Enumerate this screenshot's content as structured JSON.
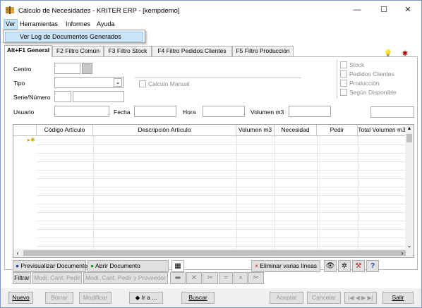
{
  "window": {
    "title": "Cálculo de Necesidades - KRITER ERP - [kempdemo]",
    "minimize": "—",
    "maximize": "☐",
    "close": "✕"
  },
  "menu": {
    "items": [
      "Ver",
      "Herramientas",
      "Informes",
      "Ayuda"
    ],
    "dropdown_item": "Ver Log de Documentos Generados"
  },
  "tabs": [
    "Alt+F1 General",
    "F2 Filtro Común",
    "F3 Filtro Stock",
    "F4 Filtro Pedidos Clientes",
    "F5 Filtro Producción"
  ],
  "form": {
    "centro_label": "Centro",
    "tipo_label": "Tipo",
    "serie_label": "Serie/Número",
    "usuario_label": "Usuario",
    "fecha_label": "Fecha",
    "hora_label": "Hora",
    "volumen_label": "Volumen m3",
    "calculo_manual": "Calculo Manual",
    "checks": [
      "Stock",
      "Pedidos Clientes",
      "Producción",
      "Según Disponible"
    ]
  },
  "grid": {
    "columns": [
      "Código Artículo",
      "Descripción Artículo",
      "Volumen m3",
      "Necesidad",
      "Pedir",
      "Total Volumen m3"
    ]
  },
  "grid_buttons": {
    "previsualizar": "Previsualizar Documento",
    "abrir": "Abrir Documento",
    "eliminar": "Eliminar varias líneas",
    "filtrar": "Filtrar",
    "mod_cant_pedir": "Modi. Cant. Pedir",
    "mod_cant_pedir_prov": "Modi. Cant. Pedir y Proveedor"
  },
  "bottom": {
    "nuevo": "Nuevo",
    "borrar": "Borrar",
    "modificar": "Modificar",
    "ir_a": "Ir a ...",
    "buscar": "Buscar",
    "aceptar": "Aceptar",
    "cancelar": "Cancelar",
    "salir": "Salir"
  }
}
